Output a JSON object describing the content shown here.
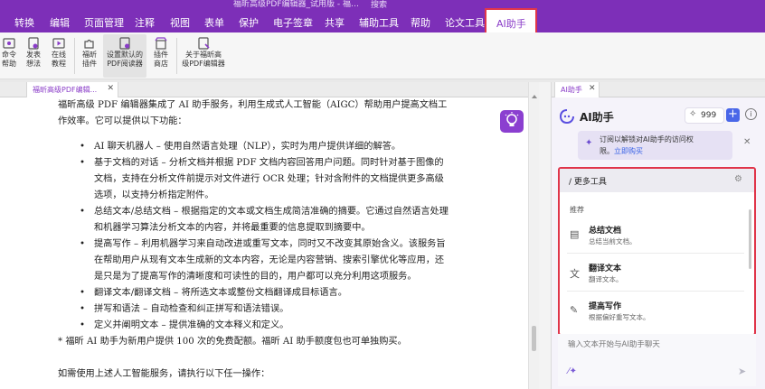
{
  "window": {
    "title": "福昕高级PDF编辑器_试用版 - 福…",
    "search_hint": "搜索"
  },
  "menu": {
    "items": [
      {
        "label": "转换",
        "x": "left:16px"
      },
      {
        "label": "编辑"
      },
      {
        "label": "页面管理"
      },
      {
        "label": "注释"
      },
      {
        "label": "视图"
      },
      {
        "label": "表单"
      },
      {
        "label": "保护"
      },
      {
        "label": "电子签章"
      },
      {
        "label": "共享"
      },
      {
        "label": "辅助工具"
      },
      {
        "label": "帮助"
      },
      {
        "label": "论文工具"
      }
    ],
    "ai_tab": "AI助手"
  },
  "ribbon": {
    "buttons": [
      {
        "label1": "命令",
        "label2": "帮助"
      },
      {
        "label1": "发表",
        "label2": "想法"
      },
      {
        "label1": "在线",
        "label2": "教程"
      },
      {
        "label1": "福昕",
        "label2": "插件"
      },
      {
        "label1": "设置默认的",
        "label2": "PDF阅读器"
      },
      {
        "label1": "插件",
        "label2": "商店"
      },
      {
        "label1": "关于福昕高",
        "label2": "级PDF编辑器"
      }
    ]
  },
  "document": {
    "tab_name": "福昕高级PDF编辑...",
    "intro": "福昕高级 PDF 编辑器集成了 AI 助手服务，利用生成式人工智能（AIGC）帮助用户提高文档工作效率。它可以提供以下功能：",
    "bullets": [
      "AI 聊天机器人 – 使用自然语言处理（NLP），实时为用户提供详细的解答。",
      "基于文档的对话 – 分析文档并根据 PDF 文档内容回答用户问题。同时针对基于图像的文档，支持在分析文件前提示对文件进行 OCR 处理；针对含附件的文档提供更多高级选项，以支持分析指定附件。",
      "总结文本/总结文档 – 根据指定的文本或文档生成简洁准确的摘要。它通过自然语言处理和机器学习算法分析文本的内容，并将最重要的信息提取到摘要中。",
      "提高写作 – 利用机器学习来自动改进或重写文本，同时又不改变其原始含义。该服务旨在帮助用户从现有文本生成新的文本内容，无论是内容营销、搜索引擎优化等应用，还是只是为了提高写作的清晰度和可读性的目的，用户都可以充分利用这项服务。",
      "翻译文本/翻译文档 – 将所选文本或整份文档翻译成目标语言。",
      "拼写和语法 – 自动检查和纠正拼写和语法错误。",
      "定义并阐明文本 – 提供准确的文本释义和定义。"
    ],
    "note": "* 福昕 AI 助手为新用户提供 100 次的免费配额。福昕 AI 助手额度包也可单独购买。",
    "last_line": "如需使用上述人工智能服务，请执行以下任一操作："
  },
  "ai_panel": {
    "tab_name": "AI助手",
    "title": "AI助手",
    "credits": "999",
    "banner_line1": "订阅以解锁对AI助手的访问权",
    "banner_line2": "限。",
    "banner_link": "立即购买",
    "tools_header": "/ 更多工具",
    "recommend_label": "推荐",
    "tools": [
      {
        "name": "总结文档",
        "desc": "总结当前文档。"
      },
      {
        "name": "翻译文本",
        "desc": "翻译文本。"
      },
      {
        "name": "提高写作",
        "desc": "根据偏好重写文本。"
      }
    ],
    "input_placeholder": "输入文本开始与AI助手聊天"
  },
  "colors": {
    "brand_purple": "#7d2fb8",
    "highlight_red": "#e0354a",
    "link_blue": "#3b63e6"
  }
}
